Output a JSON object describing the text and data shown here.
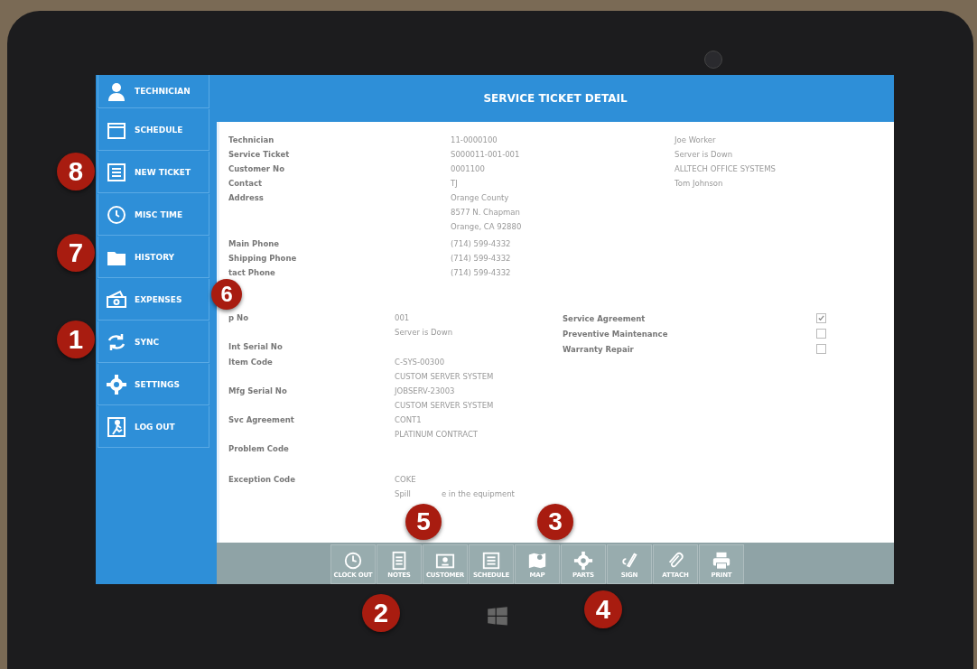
{
  "sidebar": {
    "items": [
      {
        "label": "TECHNICIAN"
      },
      {
        "label": "SCHEDULE"
      },
      {
        "label": "NEW TICKET"
      },
      {
        "label": "MISC TIME"
      },
      {
        "label": "HISTORY"
      },
      {
        "label": "EXPENSES"
      },
      {
        "label": "SYNC"
      },
      {
        "label": "SETTINGS"
      },
      {
        "label": "LOG OUT"
      }
    ]
  },
  "header": {
    "title": "SERVICE TICKET DETAIL"
  },
  "customer_section": {
    "rows": [
      {
        "label": "Technician",
        "lines": [
          "11-0000100"
        ],
        "note": "Joe Worker"
      },
      {
        "label": "Service Ticket",
        "lines": [
          "S000011-001-001"
        ],
        "note": "Server is Down"
      },
      {
        "label": "Customer No",
        "lines": [
          "0001100"
        ],
        "note": "ALLTECH OFFICE SYSTEMS"
      },
      {
        "label": "Contact",
        "lines": [
          "TJ"
        ],
        "note": "Tom Johnson"
      },
      {
        "label": "Address",
        "lines": [
          "Orange County",
          "8577 N. Chapman",
          "Orange, CA 92880"
        ]
      },
      {
        "label": "Main Phone",
        "lines": [
          "(714) 599-4332"
        ]
      },
      {
        "label": "Shipping Phone",
        "lines": [
          "(714) 599-4332"
        ]
      },
      {
        "label": "tact Phone",
        "lines": [
          "(714) 599-4332"
        ]
      }
    ]
  },
  "equipment_section": {
    "fields": [
      {
        "label": "p No",
        "lines": [
          "001",
          "Server is Down"
        ]
      },
      {
        "label": "Int Serial No"
      },
      {
        "label": "Item Code",
        "lines": [
          "C-SYS-00300",
          "CUSTOM SERVER SYSTEM"
        ]
      },
      {
        "label": "Mfg Serial No",
        "lines": [
          "JOBSERV-23003",
          "CUSTOM SERVER SYSTEM"
        ]
      },
      {
        "label": "Svc Agreement",
        "lines": [
          "CONT1",
          "PLATINUM CONTRACT"
        ]
      },
      {
        "label": "Problem Code"
      },
      {
        "label": "Exception Code",
        "lines": [
          "COKE",
          "Spill",
          "e in the equipment"
        ]
      }
    ],
    "flags": [
      {
        "label": "Service Agreement",
        "checked": true
      },
      {
        "label": "Preventive Maintenance",
        "checked": false
      },
      {
        "label": "Warranty Repair",
        "checked": false
      }
    ]
  },
  "toolbar": {
    "buttons": [
      {
        "label": "CLOCK OUT"
      },
      {
        "label": "NOTES"
      },
      {
        "label": "CUSTOMER"
      },
      {
        "label": "SCHEDULE"
      },
      {
        "label": "MAP"
      },
      {
        "label": "PARTS"
      },
      {
        "label": "SIGN"
      },
      {
        "label": "ATTACH"
      },
      {
        "label": "PRINT"
      }
    ]
  },
  "callouts": [
    "8",
    "7",
    "6",
    "1",
    "5",
    "3",
    "4",
    "2"
  ]
}
